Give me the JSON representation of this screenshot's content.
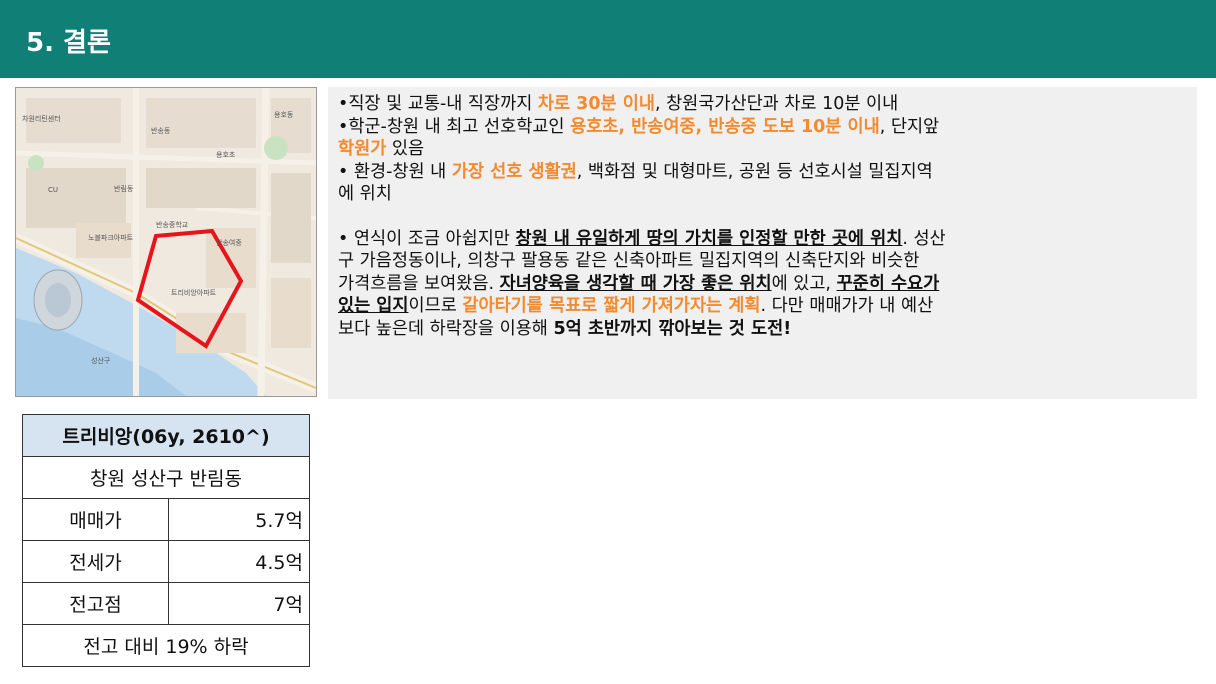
{
  "header": {
    "title": "5. 결론"
  },
  "map": {
    "labels": [
      "차원리틴센터",
      "반송동",
      "반송중학교",
      "반림동",
      "노블파크아파트",
      "트리비앙아파트",
      "용호초",
      "반송여중",
      "CU",
      "성산구",
      "용호동"
    ],
    "highlight_color": "#e8141c"
  },
  "bullets": {
    "l1a": "•직장 및 교통-내 직장까지 ",
    "l1b": "차로 30분 이내",
    "l1c": ", 창원국가산단과 차로 10분 이내",
    "l2a": "•학군-창원 내 최고 선호학교인 ",
    "l2b": "용호초, 반송여중, 반송중 도보 10분 이내",
    "l2c": ", 단지앞",
    "l3a": "학원가",
    "l3b": " 있음",
    "l4a": "• 환경-창원 내 ",
    "l4b": "가장 선호 생활권",
    "l4c": ", 백화점 및 대형마트, 공원 등 선호시설 밀집지역",
    "l5": "에 위치"
  },
  "conclusion": {
    "p1a": "• 연식이 조금 아쉽지만 ",
    "p1b": "창원 내 유일하게 땅의 가치를 인정할 만한 곳에 위치",
    "p1c": ". 성산",
    "p2": "구 가음정동이나, 의창구 팔용동 같은 신축아파트 밀집지역의 신축단지와 비슷한",
    "p3a": "가격흐름을 보여왔음. ",
    "p3b": "자녀양육을 생각할 때 가장 좋은 위치",
    "p3c": "에 있고, ",
    "p3d": "꾸준히 수요가",
    "p4a": "있는 입지",
    "p4b": "이므로 ",
    "p4c": "갈아타기를 목표로 짧게 가져가자는 계획",
    "p4d": ". 다만 매매가가 내 예산",
    "p5a": "보다 높은데 하락장을 이용해 ",
    "p5b": "5억 초반까지 깎아보는 것 도전!"
  },
  "table": {
    "title": "트리비앙(06y, 2610^)",
    "location": "창원 성산구 반림동",
    "rows": [
      {
        "label": "매매가",
        "value": "5.7억"
      },
      {
        "label": "전세가",
        "value": "4.5억"
      },
      {
        "label": "전고점",
        "value": "7억"
      }
    ],
    "footer": "전고 대비 19% 하락"
  }
}
